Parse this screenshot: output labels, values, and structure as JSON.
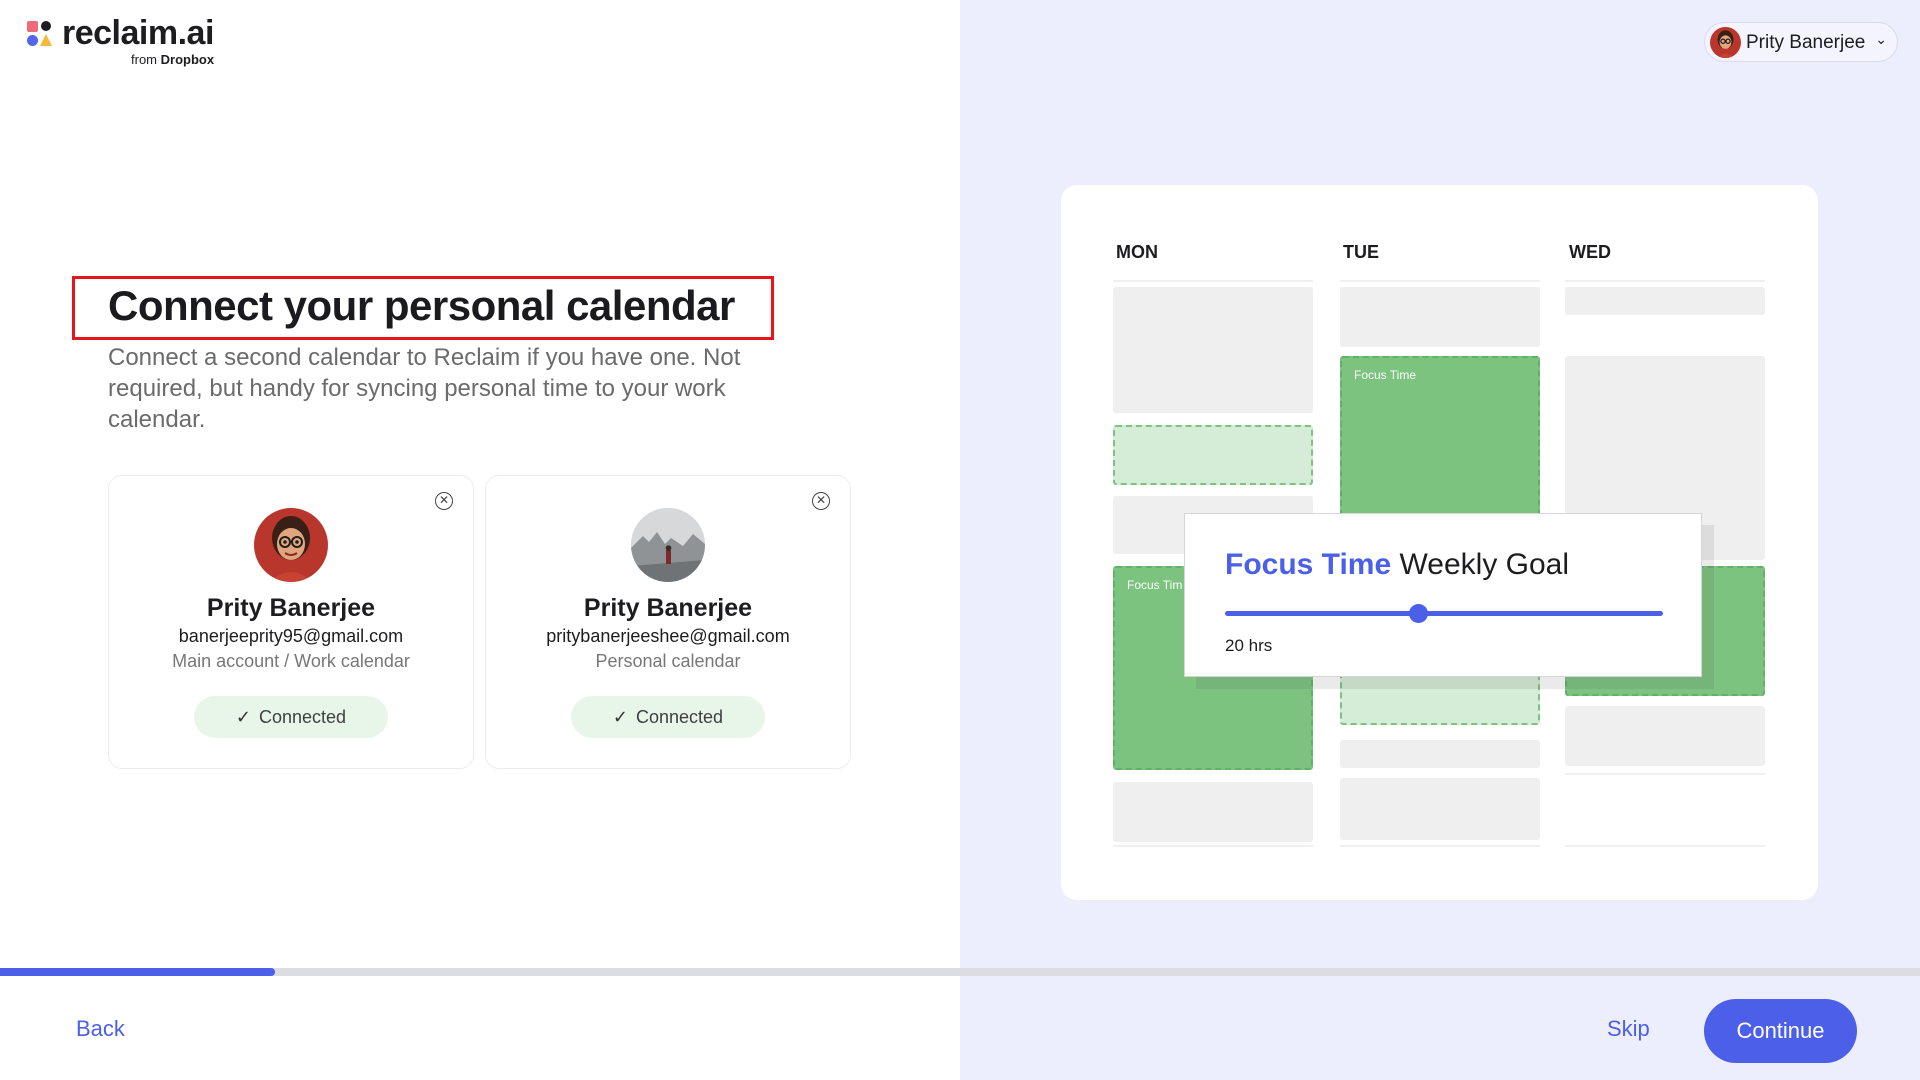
{
  "brand": {
    "name": "reclaim.ai",
    "sub_prefix": "from",
    "sub_brand": "Dropbox"
  },
  "user_menu": {
    "name": "Prity Banerjee"
  },
  "page": {
    "title": "Connect your personal calendar",
    "subtitle": "Connect a second calendar to Reclaim if you have one. Not required, but handy for syncing personal time to your work calendar."
  },
  "accounts": [
    {
      "name": "Prity Banerjee",
      "email": "banerjeeprity95@gmail.com",
      "role": "Main account / Work calendar",
      "status": "Connected"
    },
    {
      "name": "Prity Banerjee",
      "email": "pritybanerjeeshee@gmail.com",
      "role": "Personal calendar",
      "status": "Connected"
    }
  ],
  "progress": {
    "fraction": 0.143
  },
  "footer": {
    "back_label": "Back",
    "skip_label": "Skip",
    "continue_label": "Continue"
  },
  "illustration": {
    "days": [
      "MON",
      "TUE",
      "WED"
    ],
    "event_label": "Focus Time",
    "event_label_truncated": "Focus Tim",
    "goal_accent": "Focus Time",
    "goal_rest": "Weekly Goal",
    "goal_value": "20 hrs",
    "goal_fraction": 0.44
  },
  "colors": {
    "accent": "#4b5fe8",
    "right_panel_bg": "#eceefd",
    "focus_green": "#7cc37f",
    "connected_bg": "#e8f6ea",
    "highlight_red": "#e8141b"
  },
  "icons": {
    "remove": "close-circle-icon",
    "check": "check-icon",
    "chevron": "chevron-down-icon"
  }
}
